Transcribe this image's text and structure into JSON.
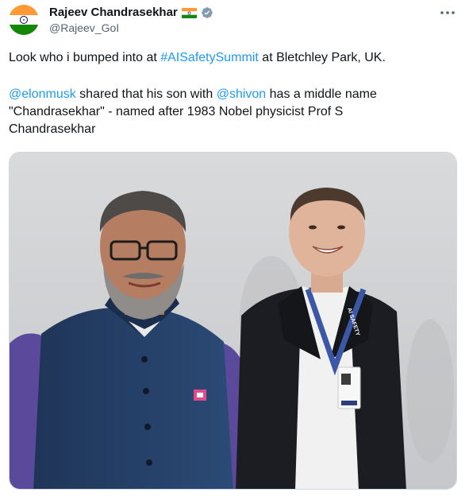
{
  "author": {
    "display_name": "Rajeev Chandrasekhar",
    "handle": "@Rajeev_GoI",
    "avatar_icon": "india-flag-avatar",
    "flag_icon": "india-flag-icon",
    "verified_icon": "grey-verified-badge-icon",
    "verified_color": "#829aab"
  },
  "menu": {
    "icon": "more-options-icon"
  },
  "tweet": {
    "p1_before": "Look who i bumped into at ",
    "p1_hashtag": "#AISafetySummit",
    "p1_after": " at Bletchley Park, UK.",
    "p2_mention1": "@elonmusk",
    "p2_mid1": " shared that his son with ",
    "p2_mention2": "@shivon",
    "p2_rest": " has a middle name \"Chandrasekhar\" - named after 1983 Nobel physicist Prof S Chandrasekhar"
  },
  "colors": {
    "link": "#1d9bf0",
    "text": "#0f1419",
    "secondary": "#536471"
  },
  "media": {
    "type": "photo",
    "lanyard_text": "AI SAFETY"
  }
}
